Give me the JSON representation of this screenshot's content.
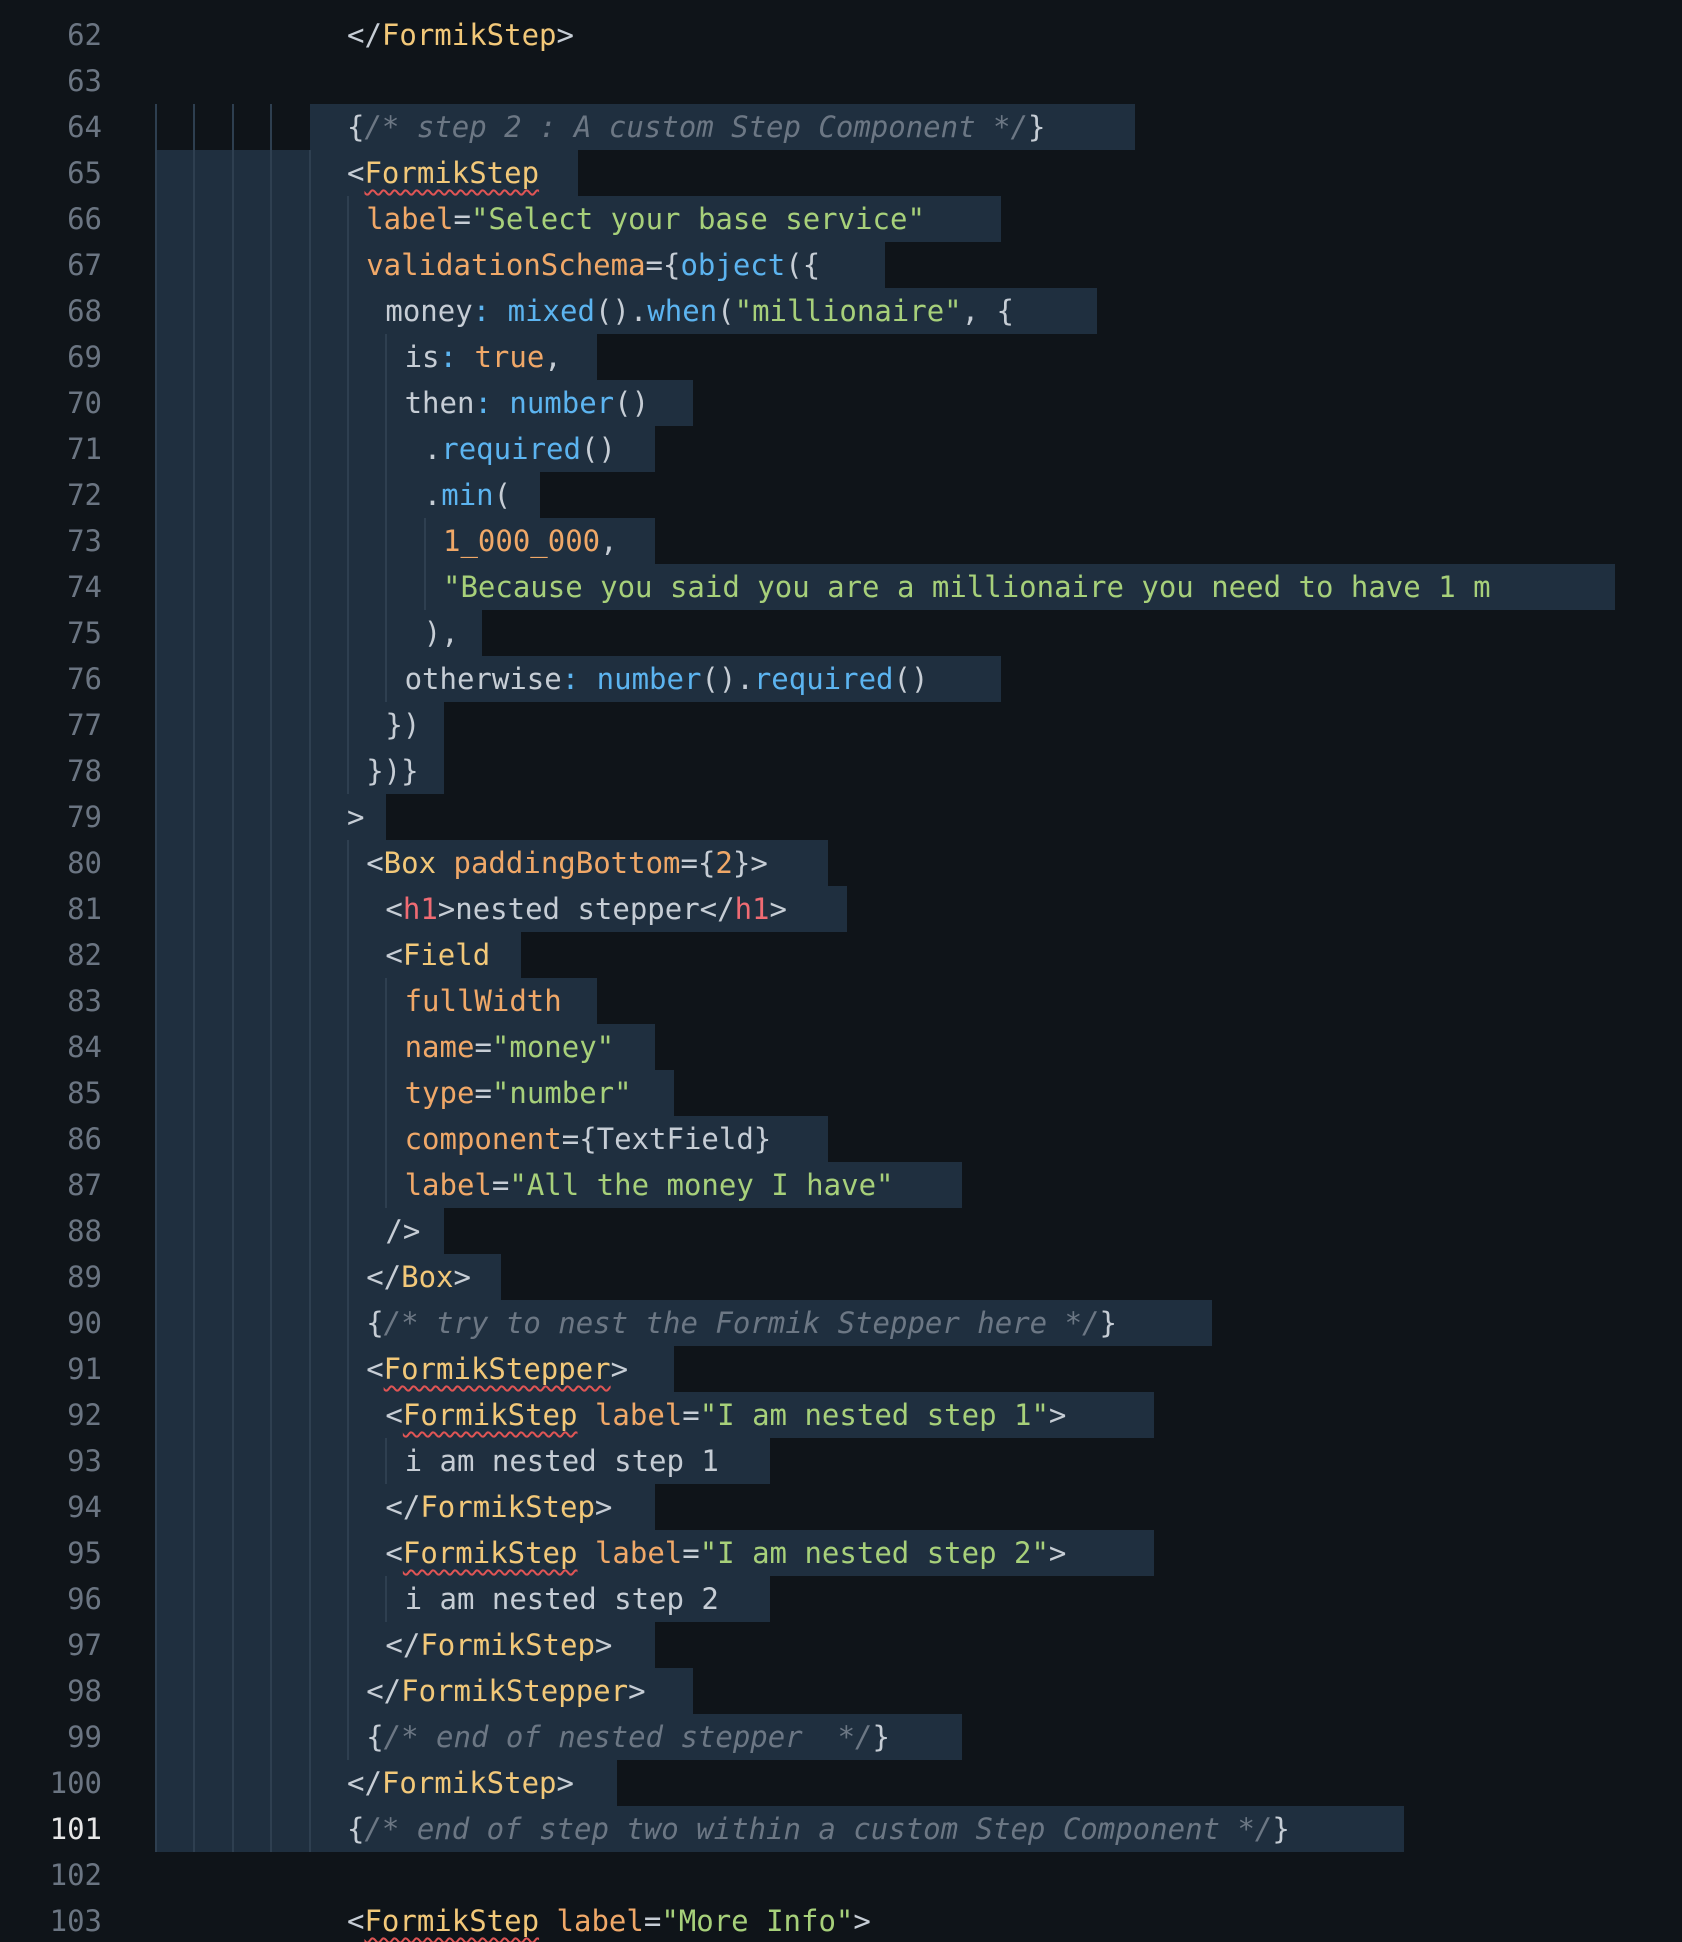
{
  "editor": {
    "active_line": 101,
    "lines": [
      {
        "n": 62,
        "indent": 5,
        "sel": false,
        "tokens": [
          {
            "t": "</",
            "c": "punc"
          },
          {
            "t": "FormikStep",
            "c": "tag"
          },
          {
            "t": ">",
            "c": "punc"
          }
        ]
      },
      {
        "n": 63,
        "indent": 0,
        "sel": false,
        "tokens": []
      },
      {
        "n": 64,
        "indent": 5,
        "sel": true,
        "guides": 4,
        "tokens": [
          {
            "t": "{",
            "c": "punc"
          },
          {
            "t": "/* step 2 : A custom Step Component */",
            "c": "cmt"
          },
          {
            "t": "}",
            "c": "punc"
          }
        ]
      },
      {
        "n": 65,
        "indent": 5,
        "sel": true,
        "guides": 5,
        "tokens": [
          {
            "t": "<",
            "c": "punc"
          },
          {
            "t": "FormikStep",
            "c": "tag squig"
          }
        ]
      },
      {
        "n": 66,
        "indent": 6,
        "sel": true,
        "guides": 6,
        "tokens": [
          {
            "t": "label",
            "c": "attr"
          },
          {
            "t": "=",
            "c": "punc"
          },
          {
            "t": "\"Select your base service\"",
            "c": "str"
          }
        ]
      },
      {
        "n": 67,
        "indent": 6,
        "sel": true,
        "guides": 6,
        "tokens": [
          {
            "t": "validationSchema",
            "c": "attr"
          },
          {
            "t": "={",
            "c": "punc"
          },
          {
            "t": "object",
            "c": "fn"
          },
          {
            "t": "({",
            "c": "punc"
          }
        ]
      },
      {
        "n": 68,
        "indent": 7,
        "sel": true,
        "guides": 7,
        "tokens": [
          {
            "t": "money",
            "c": "prop"
          },
          {
            "t": ": ",
            "c": "fn"
          },
          {
            "t": "mixed",
            "c": "fn"
          },
          {
            "t": "().",
            "c": "punc"
          },
          {
            "t": "when",
            "c": "fn"
          },
          {
            "t": "(",
            "c": "punc"
          },
          {
            "t": "\"millionaire\"",
            "c": "str"
          },
          {
            "t": ", {",
            "c": "punc"
          }
        ]
      },
      {
        "n": 69,
        "indent": 8,
        "sel": true,
        "guides": 8,
        "tokens": [
          {
            "t": "is",
            "c": "prop"
          },
          {
            "t": ": ",
            "c": "fn"
          },
          {
            "t": "true",
            "c": "kw"
          },
          {
            "t": ",",
            "c": "punc"
          }
        ]
      },
      {
        "n": 70,
        "indent": 8,
        "sel": true,
        "guides": 8,
        "tokens": [
          {
            "t": "then",
            "c": "prop"
          },
          {
            "t": ": ",
            "c": "fn"
          },
          {
            "t": "number",
            "c": "fn"
          },
          {
            "t": "()",
            "c": "punc"
          }
        ]
      },
      {
        "n": 71,
        "indent": 9,
        "sel": true,
        "guides": 9,
        "tokens": [
          {
            "t": ".",
            "c": "punc"
          },
          {
            "t": "required",
            "c": "fn"
          },
          {
            "t": "()",
            "c": "punc"
          }
        ]
      },
      {
        "n": 72,
        "indent": 9,
        "sel": true,
        "guides": 9,
        "tokens": [
          {
            "t": ".",
            "c": "punc"
          },
          {
            "t": "min",
            "c": "fn"
          },
          {
            "t": "(",
            "c": "punc"
          }
        ]
      },
      {
        "n": 73,
        "indent": 10,
        "sel": true,
        "guides": 10,
        "tokens": [
          {
            "t": "1_000_000",
            "c": "num"
          },
          {
            "t": ",",
            "c": "punc"
          }
        ]
      },
      {
        "n": 74,
        "indent": 10,
        "sel": true,
        "guides": 10,
        "tokens": [
          {
            "t": "\"Because you said you are a millionaire you need to have 1 m",
            "c": "str"
          }
        ]
      },
      {
        "n": 75,
        "indent": 9,
        "sel": true,
        "guides": 9,
        "tokens": [
          {
            "t": "),",
            "c": "punc"
          }
        ]
      },
      {
        "n": 76,
        "indent": 8,
        "sel": true,
        "guides": 8,
        "tokens": [
          {
            "t": "otherwise",
            "c": "prop"
          },
          {
            "t": ": ",
            "c": "fn"
          },
          {
            "t": "number",
            "c": "fn"
          },
          {
            "t": "().",
            "c": "punc"
          },
          {
            "t": "required",
            "c": "fn"
          },
          {
            "t": "()",
            "c": "punc"
          }
        ]
      },
      {
        "n": 77,
        "indent": 7,
        "sel": true,
        "guides": 7,
        "tokens": [
          {
            "t": "})",
            "c": "punc"
          }
        ]
      },
      {
        "n": 78,
        "indent": 6,
        "sel": true,
        "guides": 6,
        "tokens": [
          {
            "t": "})}",
            "c": "punc"
          }
        ]
      },
      {
        "n": 79,
        "indent": 5,
        "sel": true,
        "guides": 5,
        "tokens": [
          {
            "t": ">",
            "c": "punc"
          }
        ]
      },
      {
        "n": 80,
        "indent": 6,
        "sel": true,
        "guides": 6,
        "tokens": [
          {
            "t": "<",
            "c": "punc"
          },
          {
            "t": "Box",
            "c": "tag"
          },
          {
            "t": " ",
            "c": "punc"
          },
          {
            "t": "paddingBottom",
            "c": "attr"
          },
          {
            "t": "={",
            "c": "punc"
          },
          {
            "t": "2",
            "c": "num"
          },
          {
            "t": "}>",
            "c": "punc"
          }
        ]
      },
      {
        "n": 81,
        "indent": 7,
        "sel": true,
        "guides": 7,
        "tokens": [
          {
            "t": "<",
            "c": "punc"
          },
          {
            "t": "h1",
            "c": "tagr"
          },
          {
            "t": ">nested stepper</",
            "c": "punc"
          },
          {
            "t": "h1",
            "c": "tagr"
          },
          {
            "t": ">",
            "c": "punc"
          }
        ]
      },
      {
        "n": 82,
        "indent": 7,
        "sel": true,
        "guides": 7,
        "tokens": [
          {
            "t": "<",
            "c": "punc"
          },
          {
            "t": "Field",
            "c": "tag"
          }
        ]
      },
      {
        "n": 83,
        "indent": 8,
        "sel": true,
        "guides": 8,
        "tokens": [
          {
            "t": "fullWidth",
            "c": "attr"
          }
        ]
      },
      {
        "n": 84,
        "indent": 8,
        "sel": true,
        "guides": 8,
        "tokens": [
          {
            "t": "name",
            "c": "attr"
          },
          {
            "t": "=",
            "c": "punc"
          },
          {
            "t": "\"money\"",
            "c": "str"
          }
        ]
      },
      {
        "n": 85,
        "indent": 8,
        "sel": true,
        "guides": 8,
        "tokens": [
          {
            "t": "type",
            "c": "attr"
          },
          {
            "t": "=",
            "c": "punc"
          },
          {
            "t": "\"number\"",
            "c": "str"
          }
        ]
      },
      {
        "n": 86,
        "indent": 8,
        "sel": true,
        "guides": 8,
        "tokens": [
          {
            "t": "component",
            "c": "attr"
          },
          {
            "t": "={TextField}",
            "c": "punc"
          }
        ]
      },
      {
        "n": 87,
        "indent": 8,
        "sel": true,
        "guides": 8,
        "tokens": [
          {
            "t": "label",
            "c": "attr"
          },
          {
            "t": "=",
            "c": "punc"
          },
          {
            "t": "\"All the money I have\"",
            "c": "str"
          }
        ]
      },
      {
        "n": 88,
        "indent": 7,
        "sel": true,
        "guides": 7,
        "tokens": [
          {
            "t": "/>",
            "c": "punc"
          }
        ]
      },
      {
        "n": 89,
        "indent": 6,
        "sel": true,
        "guides": 6,
        "tokens": [
          {
            "t": "</",
            "c": "punc"
          },
          {
            "t": "Box",
            "c": "tag"
          },
          {
            "t": ">",
            "c": "punc"
          }
        ]
      },
      {
        "n": 90,
        "indent": 6,
        "sel": true,
        "guides": 6,
        "tokens": [
          {
            "t": "{",
            "c": "punc"
          },
          {
            "t": "/* try to nest the Formik Stepper here */",
            "c": "cmt"
          },
          {
            "t": "}",
            "c": "punc"
          }
        ]
      },
      {
        "n": 91,
        "indent": 6,
        "sel": true,
        "guides": 6,
        "tokens": [
          {
            "t": "<",
            "c": "punc"
          },
          {
            "t": "FormikStepper",
            "c": "tag squig"
          },
          {
            "t": ">",
            "c": "punc"
          }
        ]
      },
      {
        "n": 92,
        "indent": 7,
        "sel": true,
        "guides": 7,
        "tokens": [
          {
            "t": "<",
            "c": "punc"
          },
          {
            "t": "FormikStep",
            "c": "tag squig"
          },
          {
            "t": " ",
            "c": "punc"
          },
          {
            "t": "label",
            "c": "attr"
          },
          {
            "t": "=",
            "c": "punc"
          },
          {
            "t": "\"I am nested step 1\"",
            "c": "str"
          },
          {
            "t": ">",
            "c": "punc"
          }
        ]
      },
      {
        "n": 93,
        "indent": 8,
        "sel": true,
        "guides": 8,
        "tokens": [
          {
            "t": "i am nested step 1",
            "c": "punc"
          }
        ]
      },
      {
        "n": 94,
        "indent": 7,
        "sel": true,
        "guides": 7,
        "tokens": [
          {
            "t": "</",
            "c": "punc"
          },
          {
            "t": "FormikStep",
            "c": "tag"
          },
          {
            "t": ">",
            "c": "punc"
          }
        ]
      },
      {
        "n": 95,
        "indent": 7,
        "sel": true,
        "guides": 7,
        "tokens": [
          {
            "t": "<",
            "c": "punc"
          },
          {
            "t": "FormikStep",
            "c": "tag squig"
          },
          {
            "t": " ",
            "c": "punc"
          },
          {
            "t": "label",
            "c": "attr"
          },
          {
            "t": "=",
            "c": "punc"
          },
          {
            "t": "\"I am nested step 2\"",
            "c": "str"
          },
          {
            "t": ">",
            "c": "punc"
          }
        ]
      },
      {
        "n": 96,
        "indent": 8,
        "sel": true,
        "guides": 8,
        "tokens": [
          {
            "t": "i am nested step 2",
            "c": "punc"
          }
        ]
      },
      {
        "n": 97,
        "indent": 7,
        "sel": true,
        "guides": 7,
        "tokens": [
          {
            "t": "</",
            "c": "punc"
          },
          {
            "t": "FormikStep",
            "c": "tag"
          },
          {
            "t": ">",
            "c": "punc"
          }
        ]
      },
      {
        "n": 98,
        "indent": 6,
        "sel": true,
        "guides": 6,
        "tokens": [
          {
            "t": "</",
            "c": "punc"
          },
          {
            "t": "FormikStepper",
            "c": "tag"
          },
          {
            "t": ">",
            "c": "punc"
          }
        ]
      },
      {
        "n": 99,
        "indent": 6,
        "sel": true,
        "guides": 6,
        "tokens": [
          {
            "t": "{",
            "c": "punc"
          },
          {
            "t": "/* end of nested stepper  */",
            "c": "cmt"
          },
          {
            "t": "}",
            "c": "punc"
          }
        ]
      },
      {
        "n": 100,
        "indent": 5,
        "sel": true,
        "guides": 5,
        "tokens": [
          {
            "t": "</",
            "c": "punc"
          },
          {
            "t": "FormikStep",
            "c": "tag"
          },
          {
            "t": ">",
            "c": "punc"
          }
        ]
      },
      {
        "n": 101,
        "indent": 5,
        "sel": true,
        "guides": 5,
        "tokens": [
          {
            "t": "{",
            "c": "punc"
          },
          {
            "t": "/* end of step two within a custom Step Component */",
            "c": "cmt"
          },
          {
            "t": "}",
            "c": "punc"
          }
        ]
      },
      {
        "n": 102,
        "indent": 0,
        "sel": false,
        "tokens": []
      },
      {
        "n": 103,
        "indent": 5,
        "sel": false,
        "tokens": [
          {
            "t": "<",
            "c": "punc"
          },
          {
            "t": "FormikStep",
            "c": "tag squig"
          },
          {
            "t": " ",
            "c": "punc"
          },
          {
            "t": "label",
            "c": "attr"
          },
          {
            "t": "=",
            "c": "punc"
          },
          {
            "t": "\"More Info\"",
            "c": "str"
          },
          {
            "t": ">",
            "c": "punc"
          }
        ]
      }
    ]
  }
}
